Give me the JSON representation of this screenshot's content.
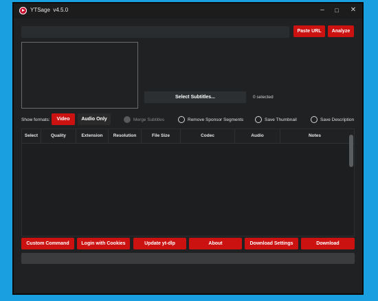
{
  "window": {
    "title": "YTSage",
    "version": "v4.5.0",
    "controls": {
      "minimize": "–",
      "maximize": "□",
      "close": "✕"
    }
  },
  "top_bar": {
    "url_value": "",
    "paste_url_label": "Paste URL",
    "analyze_label": "Analyze"
  },
  "subtitles": {
    "select_label": "Select Subtitles...",
    "selected_count": "0 selected"
  },
  "formats": {
    "show_formats_label": "Show formats:",
    "video_label": "Video",
    "audio_only_label": "Audio Only",
    "active": "Video"
  },
  "options": {
    "merge_subtitles": "Merge Subtitles",
    "remove_sponsor": "Remove Sponsor Segments",
    "save_thumbnail": "Save Thumbnail",
    "save_description": "Save Description"
  },
  "table": {
    "columns": [
      "Select",
      "Quality",
      "Extension",
      "Resolution",
      "File Size",
      "Codec",
      "Audio",
      "Notes"
    ],
    "rows": []
  },
  "actions": {
    "custom_command": "Custom Command",
    "login_cookies": "Login with Cookies",
    "update_ytdlp": "Update yt-dlp",
    "about": "About",
    "download_settings": "Download Settings",
    "download": "Download"
  },
  "progress": {
    "value": 0
  },
  "colors": {
    "accent": "#cc1111",
    "background": "#1f2123",
    "desktop": "#1a9fe0"
  }
}
